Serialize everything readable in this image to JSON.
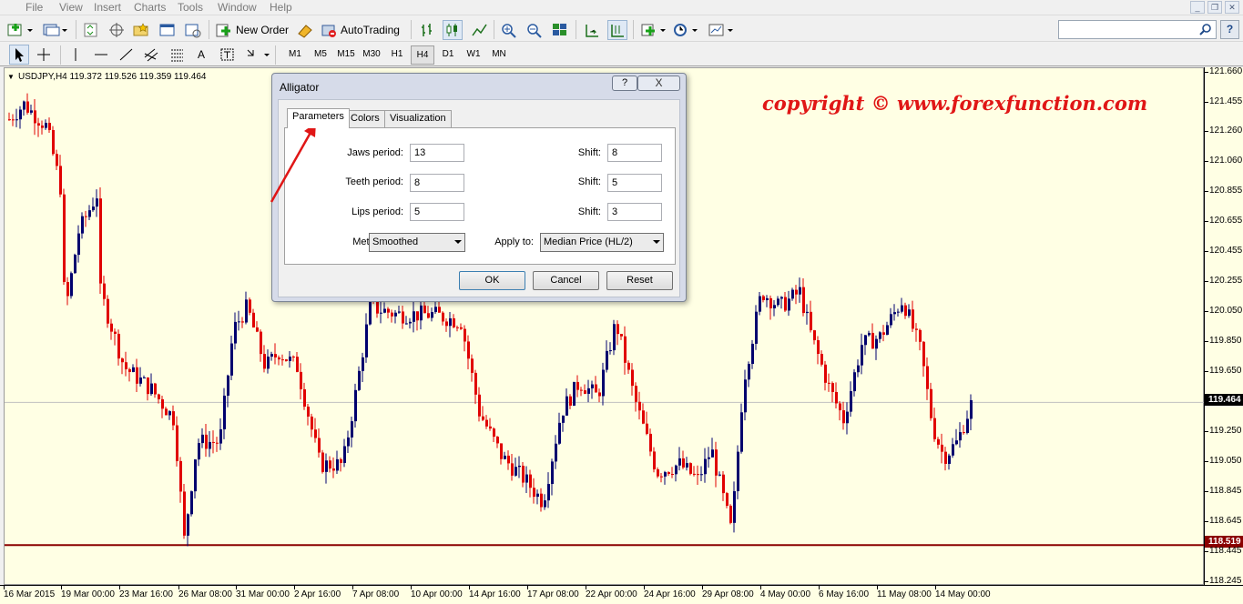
{
  "menubar": {
    "items": [
      "File",
      "View",
      "Insert",
      "Charts",
      "Tools",
      "Window",
      "Help"
    ]
  },
  "toolbar": {
    "new_order_label": "New Order",
    "autotrading_label": "AutoTrading"
  },
  "timeframes": [
    "M1",
    "M5",
    "M15",
    "M30",
    "H1",
    "H4",
    "D1",
    "W1",
    "MN"
  ],
  "active_timeframe": "H4",
  "chart": {
    "symbol_info": "USDJPY,H4  119.372 119.526 119.359 119.464",
    "watermark": "copyright ©  www.forexfunction.com",
    "price_labels": [
      "121.660",
      "121.455",
      "121.260",
      "121.060",
      "120.855",
      "120.655",
      "120.455",
      "120.255",
      "120.050",
      "119.850",
      "119.650",
      "119.464",
      "119.250",
      "119.050",
      "118.845",
      "118.645",
      "118.519",
      "118.445",
      "118.245"
    ],
    "current_price": "119.464",
    "support_price": "118.519",
    "time_labels": [
      "16 Mar 2015",
      "19 Mar 00:00",
      "23 Mar 16:00",
      "26 Mar 08:00",
      "31 Mar 00:00",
      "2 Apr 16:00",
      "7 Apr 08:00",
      "10 Apr 00:00",
      "14 Apr 16:00",
      "17 Apr 08:00",
      "22 Apr 00:00",
      "24 Apr 16:00",
      "29 Apr 08:00",
      "4 May 00:00",
      "6 May 16:00",
      "11 May 08:00",
      "14 May 00:00"
    ],
    "colors": {
      "background": "#ffffe4",
      "bull": "#00006e",
      "bear": "#e00000",
      "support_line": "#8b0000",
      "current_line": "#c0c0c0"
    }
  },
  "dialog": {
    "title": "Alligator",
    "help_label": "?",
    "close_label": "X",
    "tabs": [
      "Parameters",
      "Colors",
      "Visualization"
    ],
    "active_tab": "Parameters",
    "fields": {
      "jaws_label": "Jaws period:",
      "jaws_value": "13",
      "jaws_shift_label": "Shift:",
      "jaws_shift_value": "8",
      "teeth_label": "Teeth period:",
      "teeth_value": "8",
      "teeth_shift_label": "Shift:",
      "teeth_shift_value": "5",
      "lips_label": "Lips period:",
      "lips_value": "5",
      "lips_shift_label": "Shift:",
      "lips_shift_value": "3",
      "method_label": "Method:",
      "method_value": "Smoothed",
      "apply_label": "Apply to:",
      "apply_value": "Median Price (HL/2)"
    },
    "buttons": {
      "ok": "OK",
      "cancel": "Cancel",
      "reset": "Reset"
    }
  }
}
